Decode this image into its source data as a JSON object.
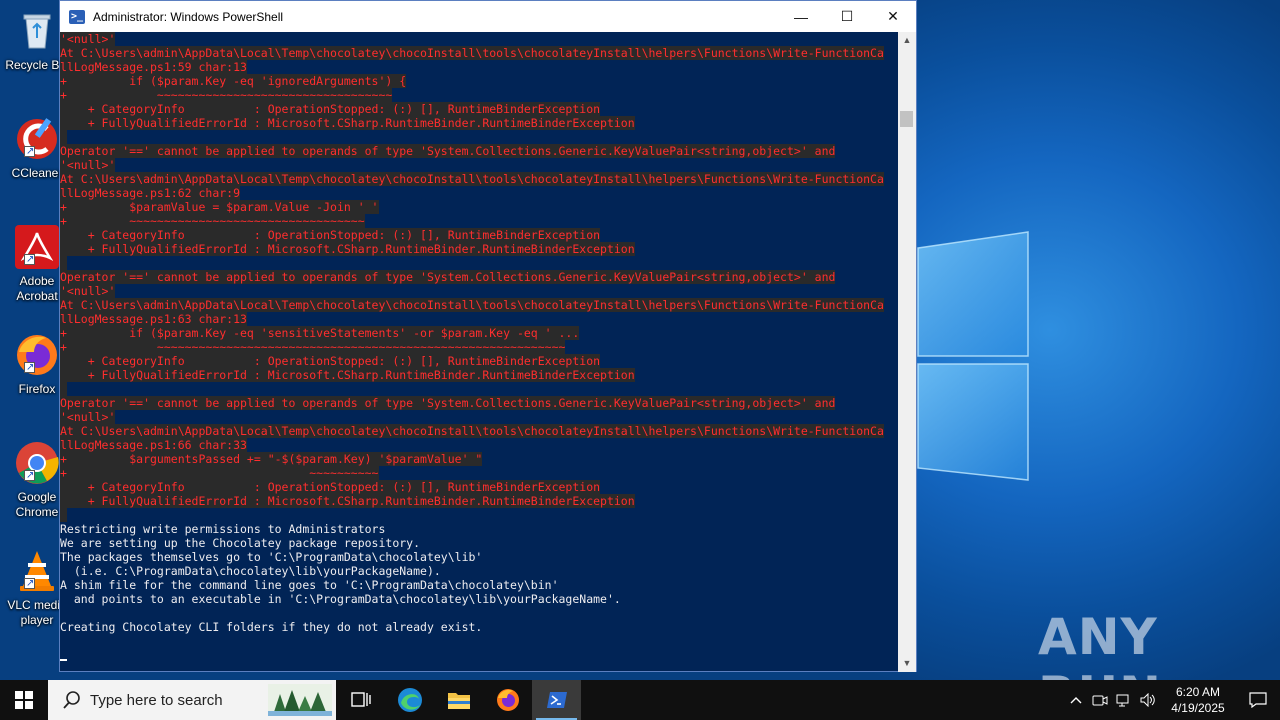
{
  "window": {
    "title": "Administrator: Windows PowerShell",
    "controls": {
      "minimize": "—",
      "maximize": "☐",
      "close": "✕"
    }
  },
  "desktop_icons": [
    {
      "label": "Recycle Bin",
      "icon": "recycle-bin-icon"
    },
    {
      "label": "CCleaner",
      "icon": "ccleaner-icon"
    },
    {
      "label": "Adobe Acrobat",
      "icon": "adobe-acrobat-icon"
    },
    {
      "label": "Firefox",
      "icon": "firefox-icon"
    },
    {
      "label": "Google Chrome",
      "icon": "chrome-icon"
    },
    {
      "label": "VLC media player",
      "icon": "vlc-icon"
    }
  ],
  "console_lines": [
    {
      "t": "'<null>'",
      "k": "err"
    },
    {
      "t": "At C:\\Users\\admin\\AppData\\Local\\Temp\\chocolatey\\chocoInstall\\tools\\chocolateyInstall\\helpers\\Functions\\Write-FunctionCa",
      "k": "err"
    },
    {
      "t": "llLogMessage.ps1:59 char:13",
      "k": "err"
    },
    {
      "t": "+         if ($param.Key -eq 'ignoredArguments') {",
      "k": "err"
    },
    {
      "t": "+             ~~~~~~~~~~~~~~~~~~~~~~~~~~~~~~~~~~",
      "k": "err"
    },
    {
      "t": "    + CategoryInfo          : OperationStopped: (:) [], RuntimeBinderException",
      "k": "err"
    },
    {
      "t": "    + FullyQualifiedErrorId : Microsoft.CSharp.RuntimeBinder.RuntimeBinderException",
      "k": "err"
    },
    {
      "t": " ",
      "k": "err"
    },
    {
      "t": "Operator '==' cannot be applied to operands of type 'System.Collections.Generic.KeyValuePair<string,object>' and",
      "k": "err"
    },
    {
      "t": "'<null>'",
      "k": "err"
    },
    {
      "t": "At C:\\Users\\admin\\AppData\\Local\\Temp\\chocolatey\\chocoInstall\\tools\\chocolateyInstall\\helpers\\Functions\\Write-FunctionCa",
      "k": "err"
    },
    {
      "t": "llLogMessage.ps1:62 char:9",
      "k": "err"
    },
    {
      "t": "+         $paramValue = $param.Value -Join ' '",
      "k": "err"
    },
    {
      "t": "+         ~~~~~~~~~~~~~~~~~~~~~~~~~~~~~~~~~~",
      "k": "err"
    },
    {
      "t": "    + CategoryInfo          : OperationStopped: (:) [], RuntimeBinderException",
      "k": "err"
    },
    {
      "t": "    + FullyQualifiedErrorId : Microsoft.CSharp.RuntimeBinder.RuntimeBinderException",
      "k": "err"
    },
    {
      "t": " ",
      "k": "err"
    },
    {
      "t": "Operator '==' cannot be applied to operands of type 'System.Collections.Generic.KeyValuePair<string,object>' and",
      "k": "err"
    },
    {
      "t": "'<null>'",
      "k": "err"
    },
    {
      "t": "At C:\\Users\\admin\\AppData\\Local\\Temp\\chocolatey\\chocoInstall\\tools\\chocolateyInstall\\helpers\\Functions\\Write-FunctionCa",
      "k": "err"
    },
    {
      "t": "llLogMessage.ps1:63 char:13",
      "k": "err"
    },
    {
      "t": "+         if ($param.Key -eq 'sensitiveStatements' -or $param.Key -eq ' ...",
      "k": "err"
    },
    {
      "t": "+             ~~~~~~~~~~~~~~~~~~~~~~~~~~~~~~~~~~~~~~~~~~~~~~~~~~~~~~~~~~~",
      "k": "err"
    },
    {
      "t": "    + CategoryInfo          : OperationStopped: (:) [], RuntimeBinderException",
      "k": "err"
    },
    {
      "t": "    + FullyQualifiedErrorId : Microsoft.CSharp.RuntimeBinder.RuntimeBinderException",
      "k": "err"
    },
    {
      "t": " ",
      "k": "err"
    },
    {
      "t": "Operator '==' cannot be applied to operands of type 'System.Collections.Generic.KeyValuePair<string,object>' and",
      "k": "err"
    },
    {
      "t": "'<null>'",
      "k": "err"
    },
    {
      "t": "At C:\\Users\\admin\\AppData\\Local\\Temp\\chocolatey\\chocoInstall\\tools\\chocolateyInstall\\helpers\\Functions\\Write-FunctionCa",
      "k": "err"
    },
    {
      "t": "llLogMessage.ps1:66 char:33",
      "k": "err"
    },
    {
      "t": "+         $argumentsPassed += \"-$($param.Key) '$paramValue' \"",
      "k": "err"
    },
    {
      "t": "+                                   ~~~~~~~~~~",
      "k": "err"
    },
    {
      "t": "    + CategoryInfo          : OperationStopped: (:) [], RuntimeBinderException",
      "k": "err"
    },
    {
      "t": "    + FullyQualifiedErrorId : Microsoft.CSharp.RuntimeBinder.RuntimeBinderException",
      "k": "err"
    },
    {
      "t": " ",
      "k": "err"
    },
    {
      "t": "Restricting write permissions to Administrators",
      "k": "norm"
    },
    {
      "t": "We are setting up the Chocolatey package repository.",
      "k": "norm"
    },
    {
      "t": "The packages themselves go to 'C:\\ProgramData\\chocolatey\\lib'",
      "k": "norm"
    },
    {
      "t": "  (i.e. C:\\ProgramData\\chocolatey\\lib\\yourPackageName).",
      "k": "norm"
    },
    {
      "t": "A shim file for the command line goes to 'C:\\ProgramData\\chocolatey\\bin'",
      "k": "norm"
    },
    {
      "t": "  and points to an executable in 'C:\\ProgramData\\chocolatey\\lib\\yourPackageName'.",
      "k": "norm"
    },
    {
      "t": "",
      "k": "norm"
    },
    {
      "t": "Creating Chocolatey CLI folders if they do not already exist.",
      "k": "norm"
    },
    {
      "t": "",
      "k": "norm"
    },
    {
      "t": "",
      "k": "cursor"
    }
  ],
  "taskbar": {
    "search_placeholder": "Type here to search",
    "time": "6:20 AM",
    "date": "4/19/2025"
  },
  "watermark": "ANY RUN",
  "colors": {
    "console_bg": "#012456",
    "error_text": "#ff2e2e",
    "normal_text": "#eeedf0",
    "accent": "#76b9ed"
  }
}
